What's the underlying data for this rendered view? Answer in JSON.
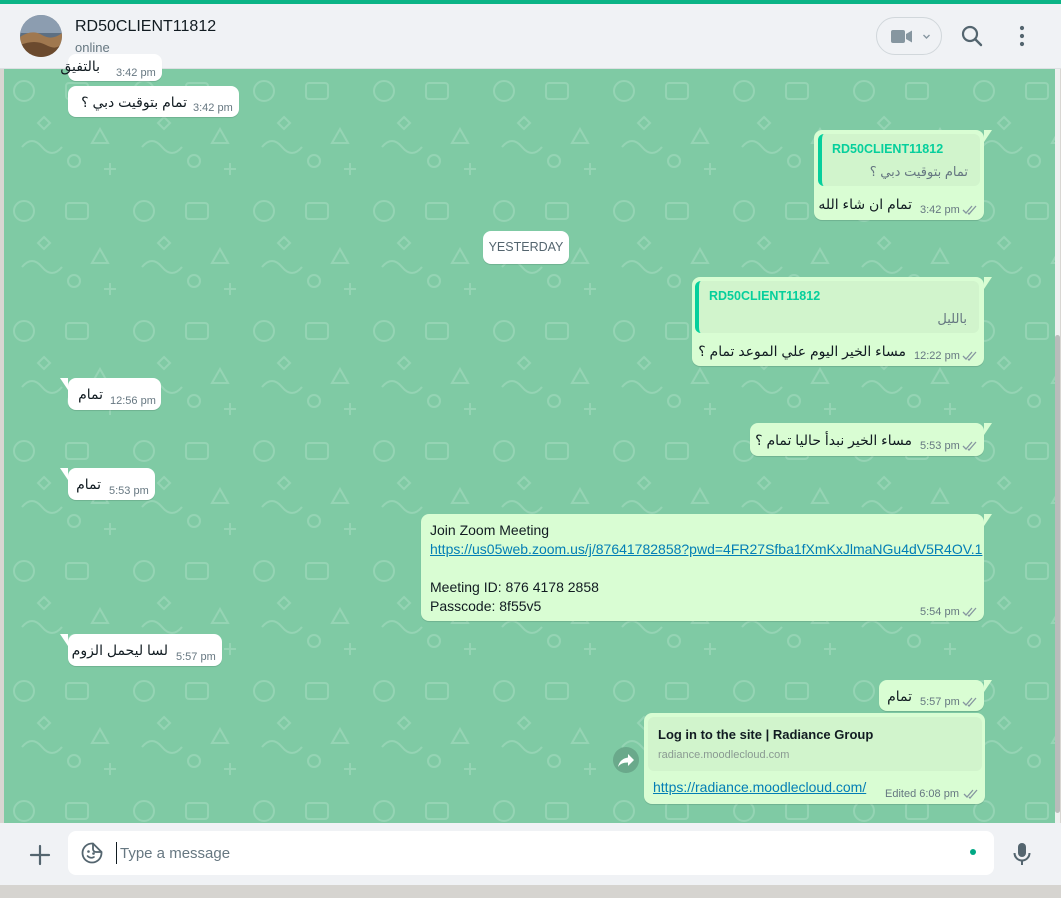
{
  "header": {
    "contact_name": "RD50CLIENT11812",
    "status": "online"
  },
  "date_divider": "YESTERDAY",
  "messages": [
    {
      "id": "m0",
      "dir": "in",
      "text": "بالتفيق",
      "time": "3:42 pm"
    },
    {
      "id": "m1",
      "dir": "in",
      "text": "تمام بتوقيت دبي ؟",
      "time": "3:42 pm"
    },
    {
      "id": "m2",
      "dir": "out",
      "quote_name": "RD50CLIENT11812",
      "quote_text": "تمام بتوقيت دبي ؟",
      "text": "تمام ان شاء الله",
      "time": "3:42 pm"
    },
    {
      "id": "m3",
      "dir": "out",
      "quote_name": "RD50CLIENT11812",
      "quote_text": "بالليل",
      "text": "مساء الخير اليوم علي الموعد تمام ؟",
      "time": "12:22 pm"
    },
    {
      "id": "m4",
      "dir": "in",
      "text": "تمام",
      "time": "12:56 pm"
    },
    {
      "id": "m5",
      "dir": "out",
      "text": "مساء الخير نبدأ حاليا تمام ؟",
      "time": "5:53 pm"
    },
    {
      "id": "m6",
      "dir": "in",
      "text": "تمام",
      "time": "5:53 pm"
    },
    {
      "id": "m7",
      "dir": "out",
      "line1": "Join Zoom Meeting",
      "link": "https://us05web.zoom.us/j/87641782858?pwd=4FR27Sfba1fXmKxJlmaNGu4dV5R4OV.1",
      "line3": "Meeting ID: 876 4178 2858",
      "line4": "Passcode: 8f55v5",
      "time": "5:54 pm"
    },
    {
      "id": "m8",
      "dir": "in",
      "text": "لسا ليحمل الزوم",
      "time": "5:57 pm"
    },
    {
      "id": "m9",
      "dir": "out",
      "text": "تمام",
      "time": "5:57 pm"
    },
    {
      "id": "m10",
      "dir": "out",
      "preview_title": "Log in to the site | Radiance Group",
      "preview_domain": "radiance.moodlecloud.com",
      "link": "https://radiance.moodlecloud.com/",
      "time": "Edited 6:08 pm"
    }
  ],
  "composer": {
    "placeholder": "Type a message"
  },
  "colors": {
    "accent": "#00a884",
    "chat_background": "#7fcaa4",
    "outgoing_bubble": "#d9fdd3",
    "incoming_bubble": "#ffffff",
    "read_ticks": "#8696a0"
  },
  "icons": {
    "header": [
      "video-camera-icon",
      "chevron-down-icon",
      "search-icon",
      "menu-dots-icon"
    ],
    "composer": [
      "plus-icon",
      "sticker-emoji-icon",
      "microphone-icon"
    ],
    "bubble": [
      "double-check-icon",
      "forward-icon"
    ]
  }
}
